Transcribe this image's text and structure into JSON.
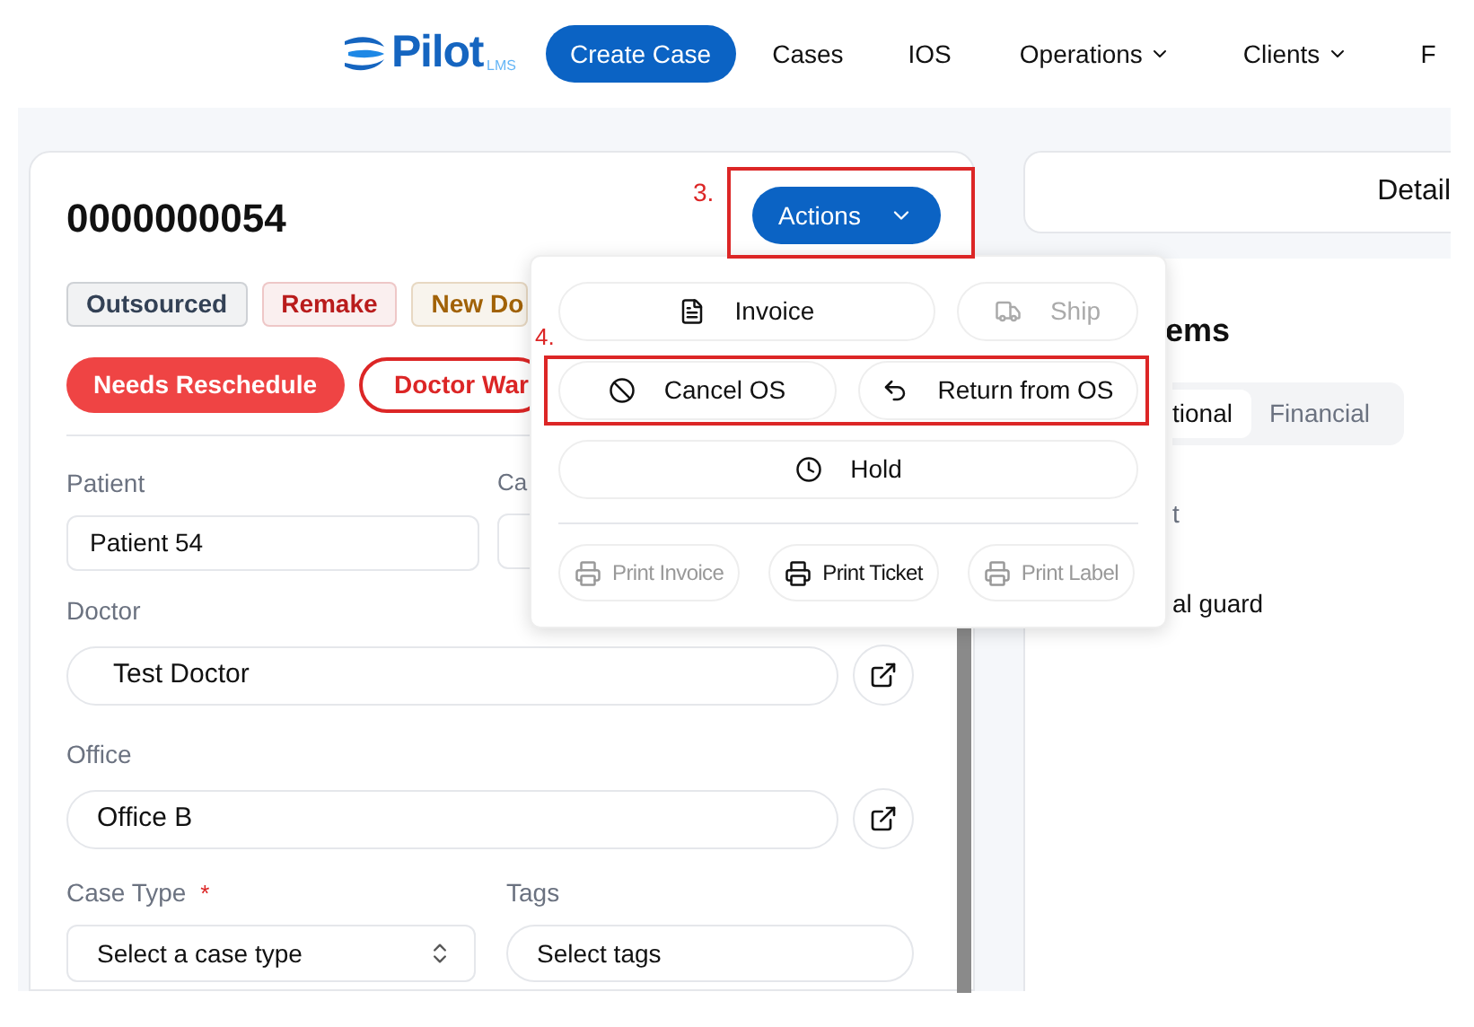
{
  "nav": {
    "logo": "Pilot",
    "logo_suffix": "LMS",
    "primary": "Create Case",
    "items": [
      {
        "label": "Cases",
        "dropdown": false
      },
      {
        "label": "IOS",
        "dropdown": false
      },
      {
        "label": "Operations",
        "dropdown": true
      },
      {
        "label": "Clients",
        "dropdown": true
      },
      {
        "label": "F",
        "dropdown": false
      }
    ]
  },
  "case": {
    "number": "0000000054",
    "actions_button": "Actions",
    "badges": [
      {
        "label": "Outsourced",
        "color": "#334155"
      },
      {
        "label": "Remake",
        "color": "#b91c1c"
      },
      {
        "label": "New Do",
        "color": "#a16207"
      }
    ],
    "flags": [
      {
        "label": "Needs Reschedule",
        "filled": true
      },
      {
        "label": "Doctor War",
        "filled": false
      }
    ],
    "fields": {
      "patient_label": "Patient",
      "patient_value": "Patient 54",
      "second_label": "Ca",
      "doctor_label": "Doctor",
      "doctor_value": "Test Doctor",
      "office_label": "Office",
      "office_value": "Office B",
      "case_type_label": "Case Type",
      "case_type_required": "*",
      "case_type_placeholder": "Select a case type",
      "tags_label": "Tags",
      "tags_placeholder": "Select tags"
    }
  },
  "right": {
    "header": "Detail",
    "heading": "ems",
    "tabs": [
      {
        "label": "tional",
        "selected": true
      },
      {
        "label": "Financial",
        "selected": false
      }
    ],
    "label": "t",
    "value": "al guard"
  },
  "menu": {
    "rows": [
      [
        {
          "label": "Invoice",
          "kind": "file",
          "disabled": false
        },
        {
          "label": "Ship",
          "kind": "truck",
          "disabled": true
        }
      ],
      [
        {
          "label": "Cancel OS",
          "kind": "ban",
          "disabled": false
        },
        {
          "label": "Return from OS",
          "kind": "undo",
          "disabled": false
        }
      ],
      [
        {
          "label": "Hold",
          "kind": "clock",
          "disabled": false
        }
      ]
    ],
    "print": [
      {
        "label": "Print Invoice",
        "disabled": true
      },
      {
        "label": "Print Ticket",
        "disabled": false
      },
      {
        "label": "Print Label",
        "disabled": true
      }
    ]
  },
  "annotations": [
    {
      "label": "3."
    },
    {
      "label": "4."
    }
  ]
}
